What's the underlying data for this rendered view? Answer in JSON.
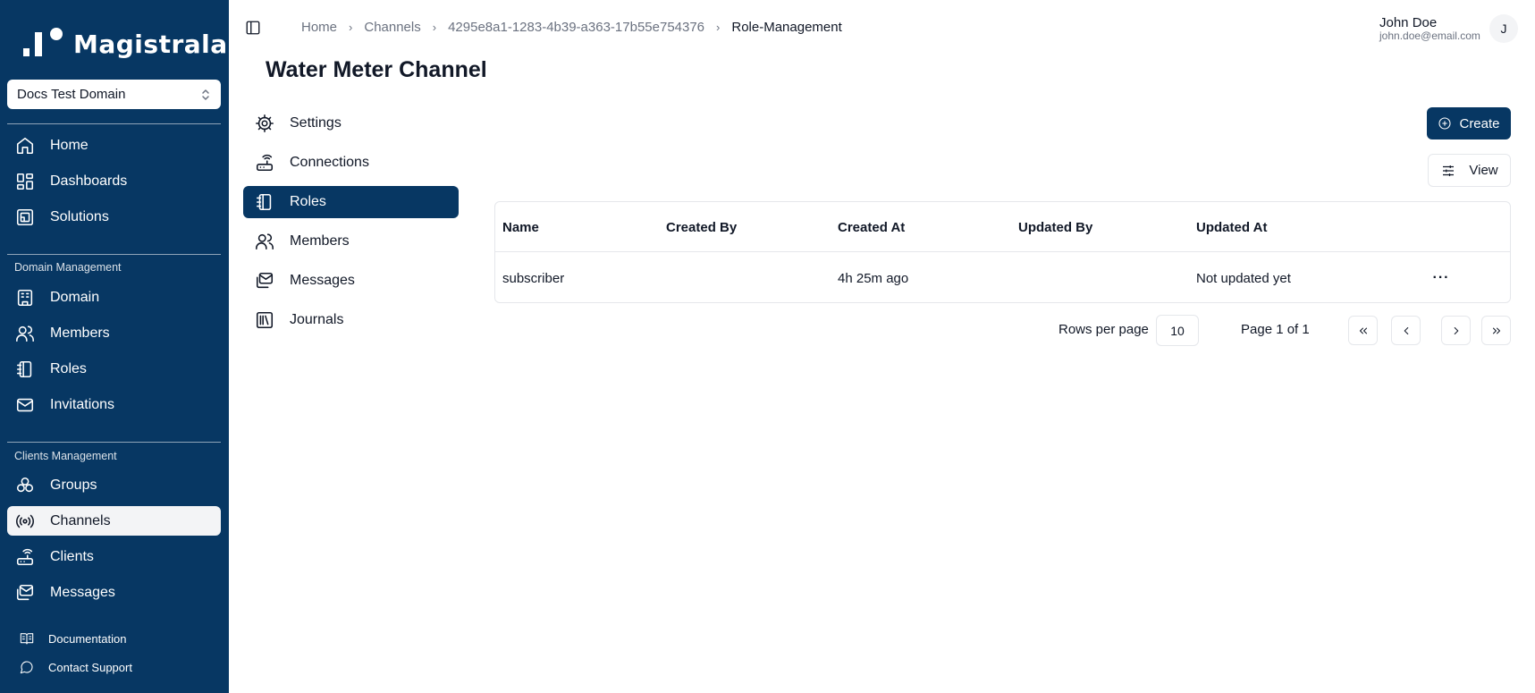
{
  "brand": {
    "name": "Magistrala"
  },
  "domain_selector": {
    "value": "Docs Test Domain"
  },
  "sidebar": {
    "main_items": [
      {
        "label": "Home",
        "icon": "home-icon"
      },
      {
        "label": "Dashboards",
        "icon": "dashboard-icon"
      },
      {
        "label": "Solutions",
        "icon": "solutions-icon"
      }
    ],
    "domain_section_label": "Domain Management",
    "domain_items": [
      {
        "label": "Domain",
        "icon": "building-icon"
      },
      {
        "label": "Members",
        "icon": "users-icon"
      },
      {
        "label": "Roles",
        "icon": "notebook-icon"
      },
      {
        "label": "Invitations",
        "icon": "mail-icon"
      }
    ],
    "clients_section_label": "Clients Management",
    "clients_items": [
      {
        "label": "Groups",
        "icon": "groups-icon"
      },
      {
        "label": "Channels",
        "icon": "radio-icon",
        "active": true
      },
      {
        "label": "Clients",
        "icon": "router-icon"
      },
      {
        "label": "Messages",
        "icon": "messages-icon"
      }
    ],
    "footer_items": [
      {
        "label": "Documentation",
        "icon": "book-icon"
      },
      {
        "label": "Contact Support",
        "icon": "chat-icon"
      }
    ]
  },
  "breadcrumb": {
    "items": [
      "Home",
      "Channels",
      "4295e8a1-1283-4b39-a363-17b55e754376"
    ],
    "current": "Role-Management"
  },
  "user": {
    "name": "John Doe",
    "email": "john.doe@email.com",
    "initial": "J"
  },
  "page": {
    "title": "Water Meter Channel"
  },
  "subnav": [
    {
      "label": "Settings",
      "icon": "gear-icon"
    },
    {
      "label": "Connections",
      "icon": "router-icon"
    },
    {
      "label": "Roles",
      "icon": "notebook-icon",
      "active": true
    },
    {
      "label": "Members",
      "icon": "users-icon"
    },
    {
      "label": "Messages",
      "icon": "messages-icon"
    },
    {
      "label": "Journals",
      "icon": "library-icon"
    }
  ],
  "actions": {
    "create_label": "Create",
    "view_label": "View"
  },
  "table": {
    "columns": [
      "Name",
      "Created By",
      "Created At",
      "Updated By",
      "Updated At"
    ],
    "rows": [
      {
        "name": "subscriber",
        "created_by": "",
        "created_at": "4h 25m ago",
        "updated_by": "",
        "updated_at": "Not updated yet",
        "more": "···"
      }
    ]
  },
  "pagination": {
    "rows_per_page_label": "Rows per page",
    "rows_per_page_value": "10",
    "page_info": "Page 1 of 1"
  },
  "colors": {
    "sidebar_bg": "#073763",
    "accent": "#073763",
    "active_item_bg": "#f3f4f6"
  }
}
